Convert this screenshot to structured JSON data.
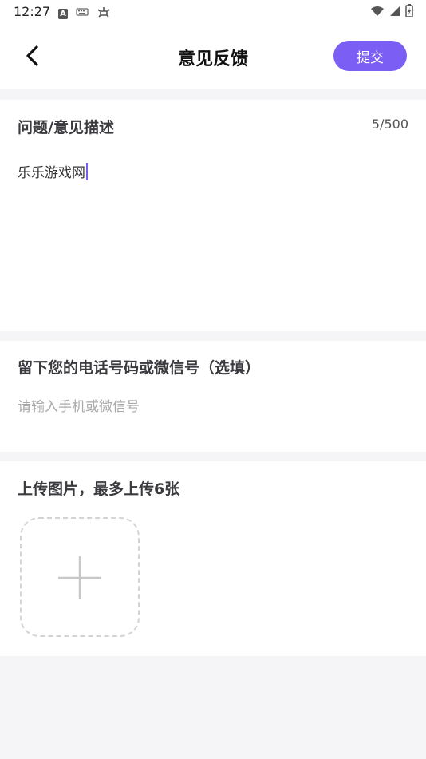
{
  "status_bar": {
    "time": "12:27",
    "icons": [
      "a-icon",
      "keyboard-icon",
      "bug-icon",
      "wifi-icon",
      "signal-icon",
      "battery-icon"
    ]
  },
  "header": {
    "title": "意见反馈",
    "submit_label": "提交",
    "accent_color": "#7b5ef3"
  },
  "description": {
    "title": "问题/意见描述",
    "counter": "5/500",
    "value": "乐乐游戏网"
  },
  "contact": {
    "title": "留下您的电话号码或微信号（选填）",
    "placeholder": "请输入手机或微信号"
  },
  "upload": {
    "title": "上传图片，最多上传6张"
  }
}
